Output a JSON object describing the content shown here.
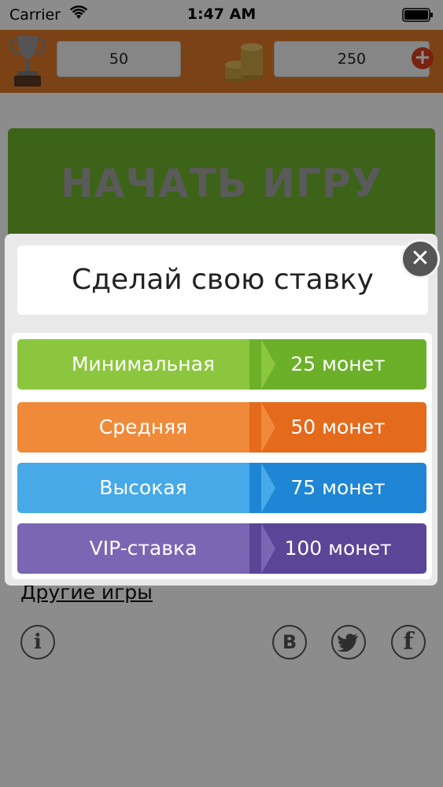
{
  "status_bar": {
    "carrier": "Carrier",
    "time": "1:47 AM"
  },
  "top_bar": {
    "score": "50",
    "coins": "250",
    "add_label": "+",
    "icons": [
      "trophy-icon",
      "coins-icon",
      "plus-icon"
    ]
  },
  "main": {
    "start_label": "НАЧАТЬ ИГРУ",
    "other_games_label": "Другие игры",
    "info_label": "i",
    "vk_label": "B",
    "fb_label": "f"
  },
  "modal": {
    "title": "Сделай свою ставку",
    "close_label": "✕",
    "options": [
      {
        "label": "Минимальная",
        "value": "25 монет",
        "color_left": "#8cc63f",
        "color_right": "#6cb02a"
      },
      {
        "label": "Средняя",
        "value": "50 монет",
        "color_left": "#ef8a3a",
        "color_right": "#e46a1c"
      },
      {
        "label": "Высокая",
        "value": "75 монет",
        "color_left": "#47a9e8",
        "color_right": "#1e86d4"
      },
      {
        "label": "VIP-ставка",
        "value": "100 монет",
        "color_left": "#7b66b4",
        "color_right": "#5b4596"
      }
    ]
  }
}
